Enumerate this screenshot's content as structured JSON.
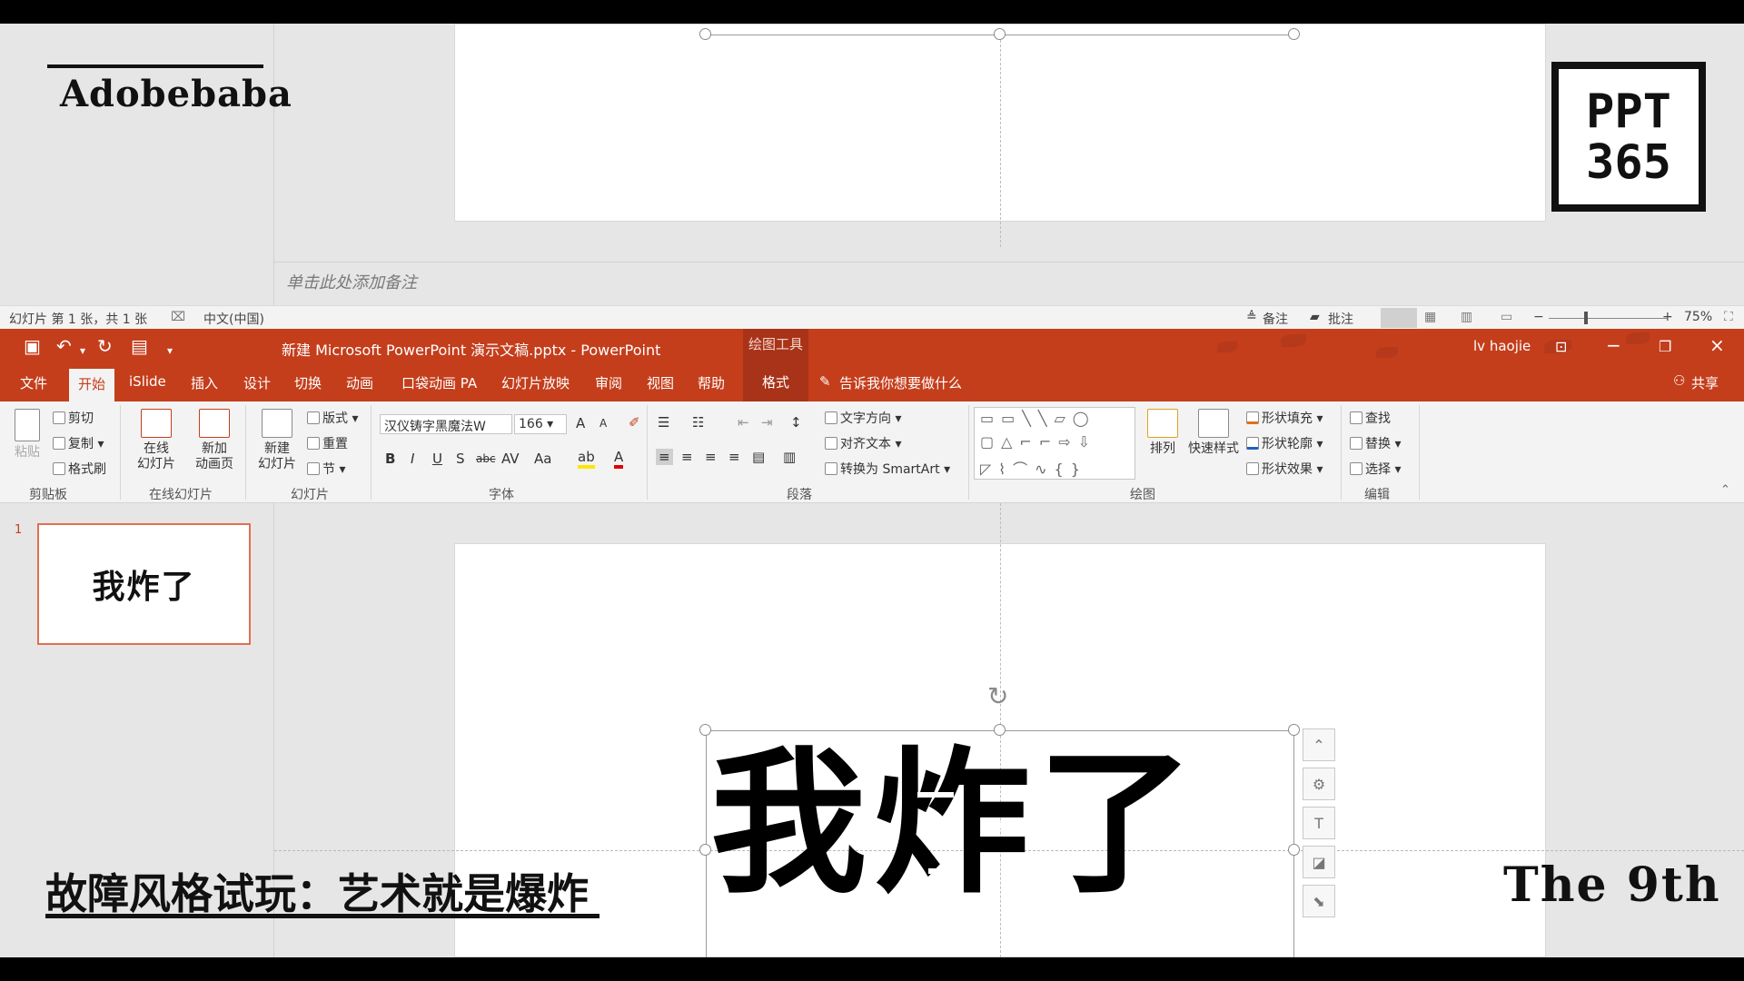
{
  "top_window": {
    "notes_placeholder": "单击此处添加备注",
    "status": {
      "slide_info": "幻灯片 第 1 张，共 1 张",
      "language": "中文(中国)",
      "notes_btn": "备注",
      "comments_btn": "批注",
      "zoom": "75%"
    }
  },
  "titlebar": {
    "doc_title": "新建 Microsoft PowerPoint 演示文稿.pptx  -  PowerPoint",
    "tools_context": "绘图工具",
    "user": "lv haojie"
  },
  "tabs": {
    "file": "文件",
    "home": "开始",
    "islide": "iSlide",
    "insert": "插入",
    "design": "设计",
    "transitions": "切换",
    "animations": "动画",
    "pocket_animation": "口袋动画 PA",
    "slideshow": "幻灯片放映",
    "review": "审阅",
    "view": "视图",
    "help": "帮助",
    "format": "格式",
    "tell_me": "告诉我你想要做什么",
    "share": "共享"
  },
  "ribbon": {
    "clipboard": {
      "paste": "粘贴",
      "cut": "剪切",
      "copy": "复制",
      "format_painter": "格式刷",
      "label": "剪贴板"
    },
    "online": {
      "online_slides_1": "在线",
      "online_slides_2": "幻灯片",
      "new_anim_1": "新加",
      "new_anim_2": "动画页",
      "label": "在线幻灯片"
    },
    "slides": {
      "new_slide_1": "新建",
      "new_slide_2": "幻灯片",
      "layout": "版式",
      "reset": "重置",
      "section": "节",
      "label": "幻灯片"
    },
    "font": {
      "name": "汉仪铸字黑魔法W",
      "size": "166",
      "label": "字体"
    },
    "paragraph": {
      "text_direction": "文字方向",
      "align_text": "对齐文本",
      "smartart": "转换为 SmartArt",
      "label": "段落"
    },
    "drawing": {
      "arrange": "排列",
      "quick_styles": "快速样式",
      "shape_fill": "形状填充",
      "shape_outline": "形状轮廓",
      "shape_effects": "形状效果",
      "label": "绘图"
    },
    "editing": {
      "find": "查找",
      "replace": "替换",
      "select": "选择",
      "label": "编辑"
    }
  },
  "slide": {
    "number": "1",
    "thumb_text": "我炸了",
    "title_text": "我炸了"
  },
  "overlay": {
    "brand": "Adobebaba",
    "logo_line1": "PPT",
    "logo_line2": "365",
    "caption": "故障风格试玩：艺术就是爆炸",
    "episode": "The 9th"
  },
  "colors": {
    "accent": "#c43e1c",
    "accent_dark": "#a93318",
    "thumb_border": "#e0714f"
  }
}
